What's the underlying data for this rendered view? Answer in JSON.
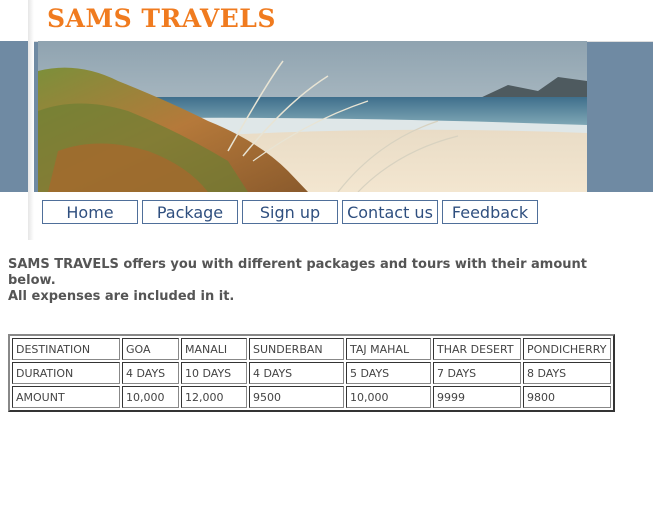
{
  "header": {
    "site_title": "SAMS TRAVELS"
  },
  "nav": {
    "items": [
      {
        "label": "Home"
      },
      {
        "label": "Package"
      },
      {
        "label": "Sign up"
      },
      {
        "label": "Contact us"
      },
      {
        "label": "Feedback"
      }
    ]
  },
  "intro": {
    "line1": "SAMS TRAVELS offers you with different packages and tours with their amount below.",
    "line2": "All expenses are included in it."
  },
  "table": {
    "rows": [
      [
        "DESTINATION",
        "GOA",
        "MANALI",
        "SUNDERBAN",
        "TAJ MAHAL",
        "THAR DESERT",
        "PONDICHERRY"
      ],
      [
        "DURATION",
        "4 DAYS",
        "10 DAYS",
        "4 DAYS",
        "5 DAYS",
        "7 DAYS",
        "8 DAYS"
      ],
      [
        "AMOUNT",
        "10,000",
        "12,000",
        "9500",
        "10,000",
        "9999",
        "9800"
      ]
    ]
  },
  "colors": {
    "title": "#f07b1f",
    "band": "#6f8aa3",
    "nav_border": "#4f6f9a",
    "nav_text": "#2f4f7f"
  }
}
